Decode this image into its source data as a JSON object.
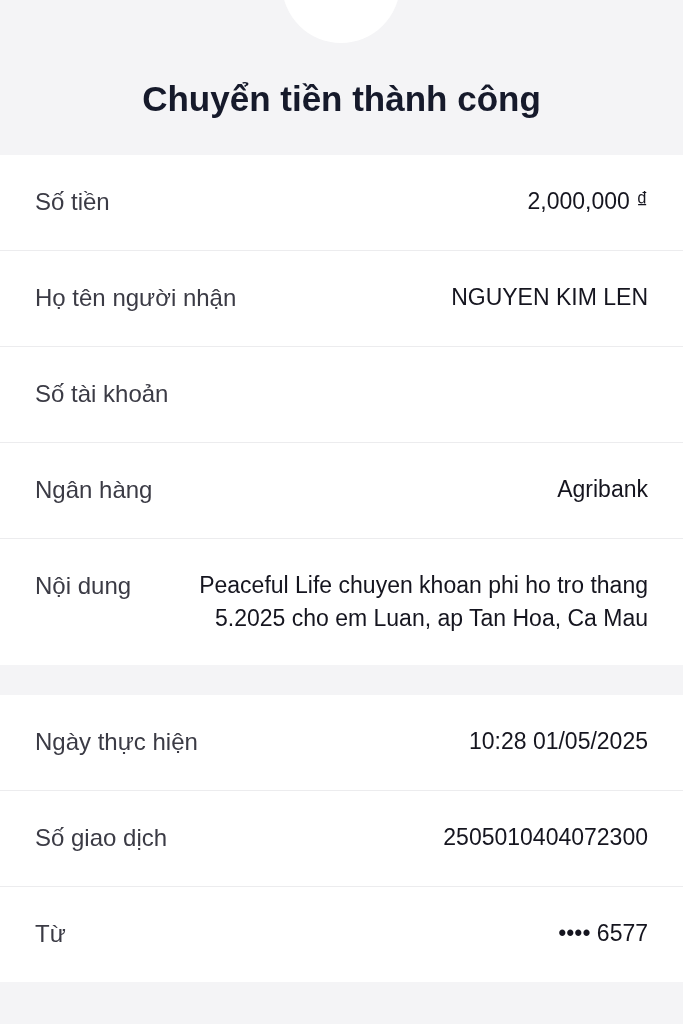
{
  "title": "Chuyển tiền thành công",
  "sections": [
    {
      "rows": [
        {
          "label": "Số tiền",
          "value": "2,000,000 ₫"
        },
        {
          "label": "Họ tên người nhận",
          "value": "NGUYEN KIM LEN"
        },
        {
          "label": "Số tài khoản"
        },
        {
          "label": "Ngân hàng",
          "value": "Agribank"
        },
        {
          "label": "Nội dung",
          "value": "Peaceful Life chuyen khoan phi ho tro thang 5.2025 cho em Luan, ap Tan Hoa, Ca Mau"
        }
      ]
    },
    {
      "rows": [
        {
          "label": "Ngày thực hiện",
          "value": "10:28 01/05/2025"
        },
        {
          "label": "Số giao dịch",
          "value": "2505010404072300"
        },
        {
          "label": "Từ",
          "value": "•••• 6577"
        }
      ]
    }
  ]
}
